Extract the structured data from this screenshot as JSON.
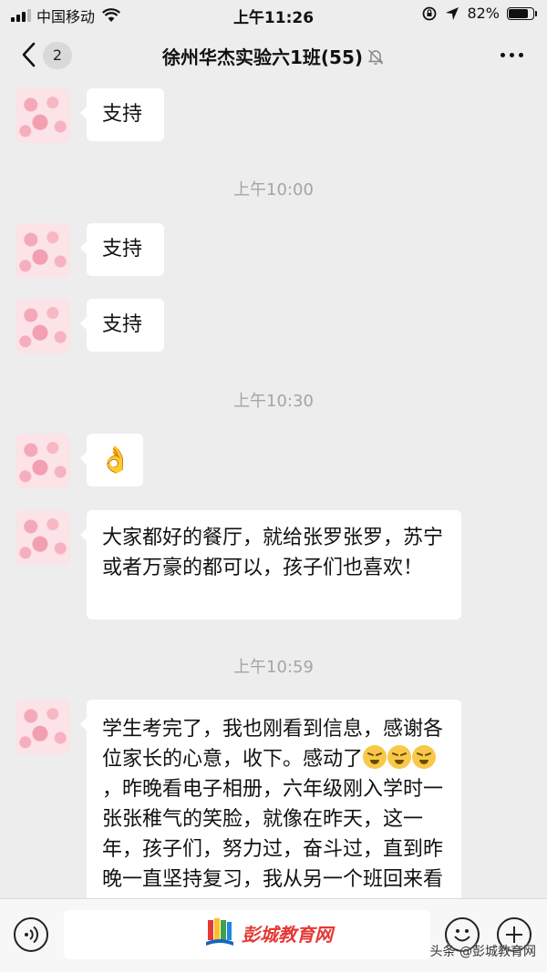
{
  "status_bar": {
    "carrier": "中国移动",
    "time": "上午11:26",
    "battery_percent": "82%",
    "battery_level": 0.82
  },
  "nav": {
    "unread_count": "2",
    "title": "徐州华杰实验六1班(55)",
    "icons": [
      "back-chevron-icon",
      "mute-bell-icon",
      "more-dots-icon"
    ]
  },
  "messages": [
    {
      "type": "text",
      "text": "支持"
    },
    {
      "type": "time",
      "text": "上午10:00"
    },
    {
      "type": "text",
      "text": "支持"
    },
    {
      "type": "text",
      "text": "支持"
    },
    {
      "type": "time",
      "text": "上午10:30"
    },
    {
      "type": "emoji",
      "icon": "ok-hand-icon",
      "glyph": "👌"
    },
    {
      "type": "text",
      "text": "大家都好的餐厅，就给张罗张罗，苏宁或者万豪的都可以，孩子们也喜欢！"
    },
    {
      "type": "time",
      "text": "上午10:59"
    },
    {
      "type": "text",
      "text_part1": "学生考完了，我也刚看到信息，感谢各位家长的心意，收下。感动了",
      "emoji_icon": "crying-laughing-face-icon",
      "emoji_count": 3,
      "text_part2": "，昨晚看电子相册，六年级刚入学时一张张稚气的笑脸，就像在昨天，这一年，孩子们，努力过，奋斗过，直到昨晚一直坚持复习，我从另一个班回来看到他们自"
    }
  ],
  "input_bar": {
    "icons": [
      "voice-icon",
      "emoji-icon",
      "plus-icon"
    ]
  },
  "watermarks": {
    "logo_text": "彭城教育网",
    "source_text": "头条 @彭城教育网"
  },
  "colors": {
    "background": "#ededed",
    "bubble": "#ffffff",
    "timestamp": "#a5a5a5",
    "watermark_red": "#e53935"
  }
}
